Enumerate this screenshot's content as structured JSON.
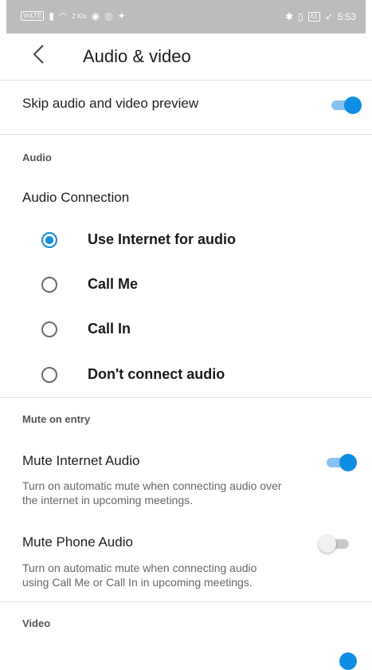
{
  "status_bar": {
    "left_chip": "VoLTE",
    "net_speed": "2 K/s",
    "battery": "61",
    "time": "5:53"
  },
  "header": {
    "title": "Audio & video"
  },
  "skip_preview": {
    "label": "Skip audio and video preview",
    "enabled": true
  },
  "audio": {
    "section_label": "Audio",
    "connection_label": "Audio Connection",
    "options": [
      {
        "label": "Use Internet for audio",
        "selected": true
      },
      {
        "label": "Call Me",
        "selected": false
      },
      {
        "label": "Call In",
        "selected": false
      },
      {
        "label": "Don't connect audio",
        "selected": false
      }
    ]
  },
  "mute_on_entry": {
    "section_label": "Mute on entry",
    "internet": {
      "label": "Mute Internet Audio",
      "desc_line1": "Turn on automatic mute when connecting audio over",
      "desc_line2": "the internet in upcoming meetings.",
      "enabled": true
    },
    "phone": {
      "label": "Mute Phone Audio",
      "desc_line1": "Turn on automatic mute when connecting audio",
      "desc_line2": "using Call Me or Call In in upcoming meetings.",
      "enabled": false
    }
  },
  "video": {
    "section_label": "Video"
  },
  "colors": {
    "accent": "#0e8ee3",
    "accent_track": "#86c2f0",
    "divider": "#e2e2e2"
  }
}
